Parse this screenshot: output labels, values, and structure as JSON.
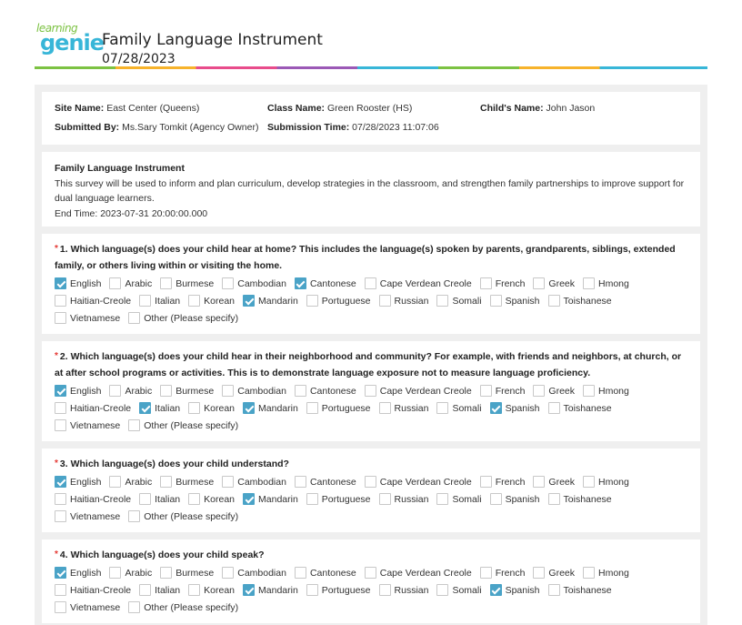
{
  "header": {
    "logo_line1": "learning",
    "logo_line2": "genie",
    "title": "Family Language Instrument",
    "date": "07/28/2023"
  },
  "info": {
    "site_label": "Site Name:",
    "site_value": "East Center (Queens)",
    "class_label": "Class Name:",
    "class_value": "Green Rooster (HS)",
    "child_label": "Child's Name:",
    "child_value": "John Jason",
    "submitted_label": "Submitted By:",
    "submitted_value": "Ms.Sary Tomkit (Agency Owner)",
    "time_label": "Submission Time:",
    "time_value": "07/28/2023 11:07:06"
  },
  "description": {
    "title": "Family Language Instrument",
    "text": "This survey will be used to inform and plan curriculum, develop strategies in the classroom, and strengthen family partnerships to improve support for dual language learners.",
    "end_time": "End Time: 2023-07-31 20:00:00.000"
  },
  "questions": [
    {
      "text": "1. Which language(s) does your child hear at home? This includes the language(s) spoken by parents, grandparents, siblings, extended family, or others living within or visiting the home.",
      "checked": [
        "English",
        "Cantonese",
        "Mandarin"
      ]
    },
    {
      "text": "2. Which language(s) does your child hear in their neighborhood and community? For example, with friends and neighbors, at church, or at after school programs or activities. This is to demonstrate language exposure not to measure language proficiency.",
      "checked": [
        "English",
        "Italian",
        "Mandarin",
        "Spanish"
      ]
    },
    {
      "text": "3. Which language(s) does your child understand?",
      "checked": [
        "English",
        "Mandarin"
      ]
    },
    {
      "text": "4. Which language(s) does your child speak?",
      "checked": [
        "English",
        "Mandarin",
        "Spanish"
      ]
    }
  ],
  "options": [
    "English",
    "Arabic",
    "Burmese",
    "Cambodian",
    "Cantonese",
    "Cape Verdean Creole",
    "French",
    "Greek",
    "Hmong",
    "Haitian-Creole",
    "Italian",
    "Korean",
    "Mandarin",
    "Portuguese",
    "Russian",
    "Somali",
    "Spanish",
    "Toishanese",
    "Vietnamese",
    "Other (Please specify)"
  ],
  "required_marker": "*",
  "colors": {
    "checkbox_checked": "#4aa3c7",
    "required": "#e53935",
    "panel_bg": "#efefef"
  }
}
